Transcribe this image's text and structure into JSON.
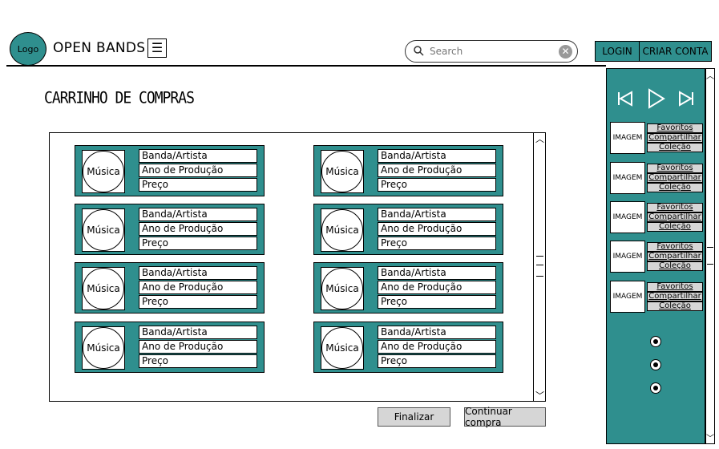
{
  "header": {
    "logo": "Logo",
    "app_title": "OPEN BANDS",
    "menu_icon": "hamburger-icon",
    "search": {
      "placeholder": "Search",
      "value": ""
    },
    "login_label": "LOGIN",
    "signup_label": "CRIAR CONTA"
  },
  "cart": {
    "title": "CARRINHO DE COMPRAS",
    "items": [
      {
        "thumb": "Música",
        "artist": "Banda/Artista",
        "year": "Ano de Produção",
        "price": "Preço"
      },
      {
        "thumb": "Música",
        "artist": "Banda/Artista",
        "year": "Ano de Produção",
        "price": "Preço"
      },
      {
        "thumb": "Música",
        "artist": "Banda/Artista",
        "year": "Ano de Produção",
        "price": "Preço"
      },
      {
        "thumb": "Música",
        "artist": "Banda/Artista",
        "year": "Ano de Produção",
        "price": "Preço"
      },
      {
        "thumb": "Música",
        "artist": "Banda/Artista",
        "year": "Ano de Produção",
        "price": "Preço"
      },
      {
        "thumb": "Música",
        "artist": "Banda/Artista",
        "year": "Ano de Produção",
        "price": "Preço"
      },
      {
        "thumb": "Música",
        "artist": "Banda/Artista",
        "year": "Ano de Produção",
        "price": "Preço"
      },
      {
        "thumb": "Música",
        "artist": "Banda/Artista",
        "year": "Ano de Produção",
        "price": "Preço"
      }
    ],
    "finalize_label": "Finalizar",
    "continue_label": "Continuar compra"
  },
  "player": {
    "controls": [
      "previous-icon",
      "play-icon",
      "next-icon"
    ]
  },
  "sidebar": {
    "items": [
      {
        "image": "IMAGEM",
        "favorites": "Favoritos",
        "share": "Compartilhar",
        "collection": "Coleção"
      },
      {
        "image": "IMAGEM",
        "favorites": "Favoritos",
        "share": "Compartilhar",
        "collection": "Coleção"
      },
      {
        "image": "IMAGEM",
        "favorites": "Favoritos",
        "share": "Compartilhar",
        "collection": "Coleção"
      },
      {
        "image": "IMAGEM",
        "favorites": "Favoritos",
        "share": "Compartilhar",
        "collection": "Coleção"
      },
      {
        "image": "IMAGEM",
        "favorites": "Favoritos",
        "share": "Compartilhar",
        "collection": "Coleção"
      }
    ],
    "pagination_dots": 3
  },
  "colors": {
    "accent": "#2f8f8e",
    "button": "#d6d6d6"
  }
}
